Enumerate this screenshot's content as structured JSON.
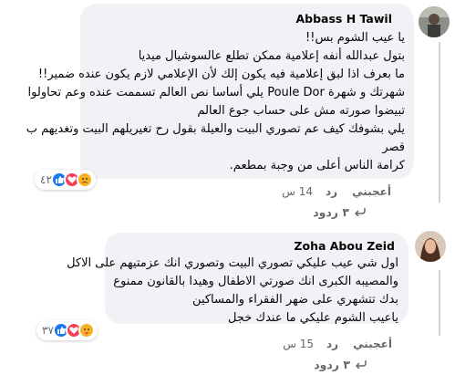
{
  "comments": [
    {
      "author": "Abbass H Tawil",
      "lines": [
        "يا عيب الشوم بس!!",
        "بتول عبدالله أنفه إعلامية ممكن تطلع عالسوشيال ميديا",
        "ما بعرف اذا لبق إعلامية فيه يكون إلك لأن الإعلامي لازم يكون عنده ضمير!!",
        "شهرتك و شهرة Poule Dor يلي أساسا نص العالم تسممت عنده وعم تحاولوا",
        "تبيضوا صورته مش على حساب جوع العالم",
        "يلي بشوفك كيف عم تصوري البيت والعيلة بقول رح تغيريلهم البيت وتغديهم ب",
        "قصر",
        "كرامة الناس أعلى من وجبة بمطعم."
      ],
      "like_label": "أعجبني",
      "reply_label": "رد",
      "time": "14 س",
      "reaction_count": "٤٢",
      "reactions": [
        "like",
        "love",
        "sad"
      ],
      "replies_label": "٣ ردود"
    },
    {
      "author": "Zoha Abou Zeid",
      "lines": [
        "اول شي عيب عليكي تصوري البيت وتصوري انك عزمتيهم على الاكل",
        "والمصيبه الكبرى انك صورتي الاطفال وهيدا بالقانون ممنوع",
        "بدك تتشهري على ضهر الفقراء والمساكين",
        "ياعيب الشوم عليكي ما عندك خجل"
      ],
      "like_label": "أعجبني",
      "reply_label": "رد",
      "time": "15 س",
      "reaction_count": "٣٧",
      "reactions": [
        "like",
        "love",
        "care"
      ],
      "replies_label": "٣ ردود"
    }
  ],
  "colors": {
    "bubble": "#f0f2f5",
    "meta_text": "#65676b",
    "like_blue": "#1877f2",
    "love_red": "#f33e58",
    "sad_yellow": "#f7b125"
  }
}
